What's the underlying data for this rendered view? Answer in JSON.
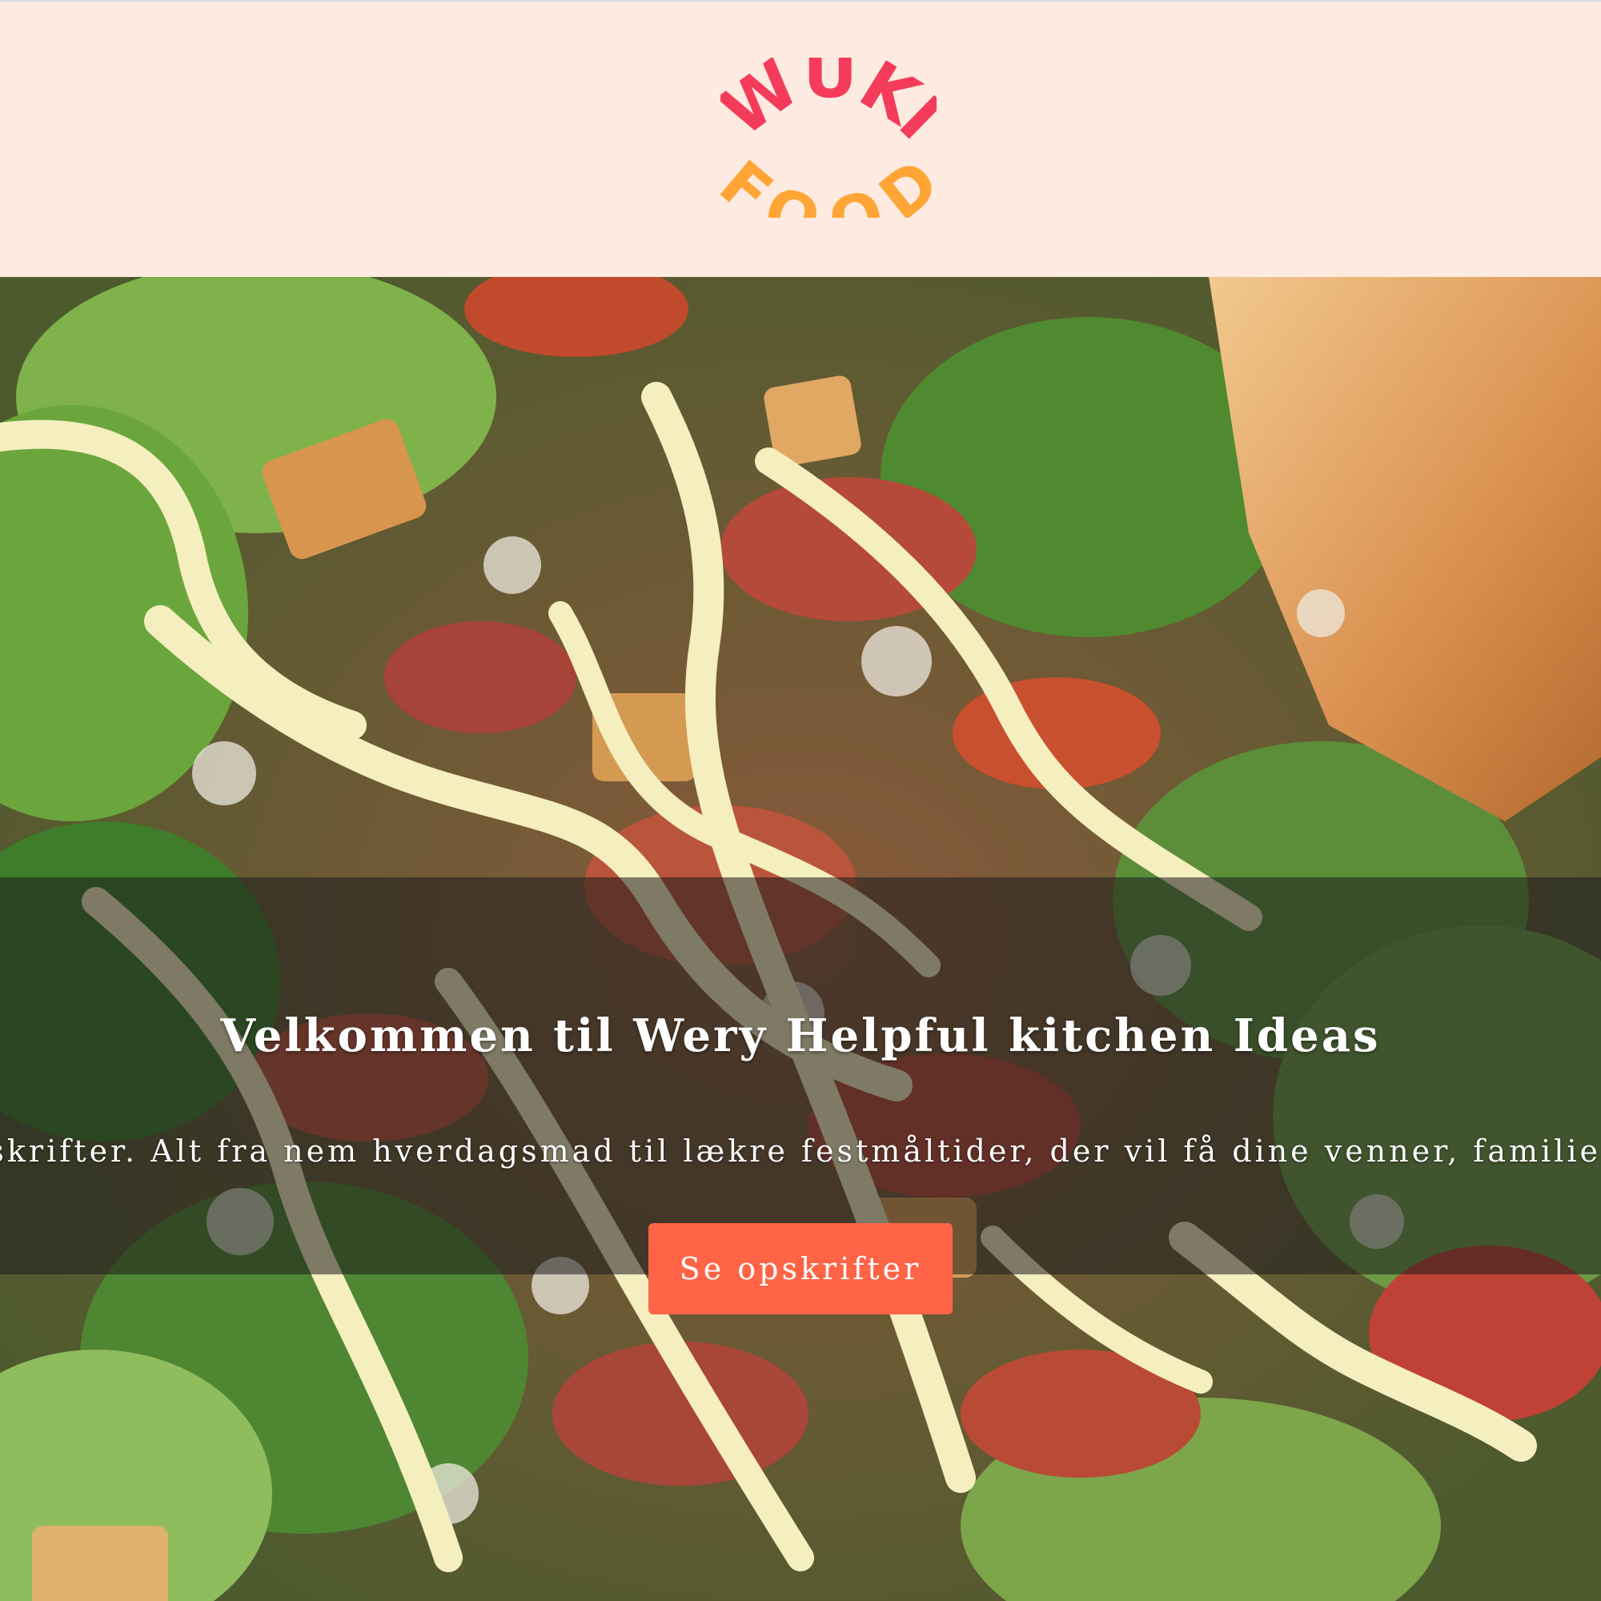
{
  "header": {
    "logo_text_top": "WUKI",
    "logo_text_bottom": "FOOD",
    "background_color": "#fdeae0",
    "logo_top_color": "#f43c5a",
    "logo_bottom_color": "#ffa535"
  },
  "hero": {
    "image_subject": "caesar-salad-photo",
    "title": "Velkommen til Wery Helpful kitchen Ideas",
    "subtitle": "opskrifter. Alt fra nem hverdagsmad til lækre festmåltider, der vil få dine venner, familie",
    "cta_label": "Se opskrifter",
    "cta_color": "#ff6446"
  }
}
